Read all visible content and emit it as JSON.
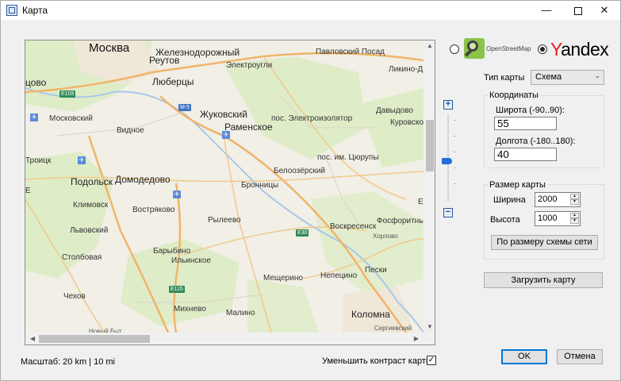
{
  "window": {
    "title": "Карта",
    "minimize": "—",
    "close": "✕"
  },
  "map": {
    "labels": {
      "moskva": "Москва",
      "zheleznodorozhny": "Железнодорожный",
      "reutov": "Реутов",
      "elektrougli": "Электроугли",
      "pavlovsky_posad": "Павловский Посад",
      "likino": "Ликино-Д",
      "lyubertsy": "Люберцы",
      "zhukovsky": "Жуковский",
      "ramenskoe": "Раменское",
      "elektroizolyator": "пос. Электроизолятор",
      "davydovo": "Давыдово",
      "kurovskoe": "Куровско",
      "moskovsky": "Московский",
      "vidnoe": "Видное",
      "tsyurupy": "пос. им. Цюрупы",
      "beloozersky": "Белоозёрский",
      "troitsk": "Троицк",
      "podolsk": "Подольск",
      "domodedovo": "Домодедово",
      "bronnitsy": "Бронницы",
      "klimovsk": "Климовск",
      "vostryakovo": "Востряково",
      "fosforitny": "Фосфоритны",
      "lvovsky": "Львовский",
      "ryleevo": "Рылеево",
      "voskresensk": "Воскресенск",
      "khorlovo": "Хорлово",
      "barybino": "Барыбино",
      "stolbovaya": "Столбовая",
      "ilyinskoe": "Ильинское",
      "peski": "Пески",
      "meshcherino": "Мещерино",
      "nepetsino": "Непецино",
      "chekhov": "Чехов",
      "mikhnevo": "Михнево",
      "malino": "Малино",
      "kolomna": "Коломна",
      "sergievsky": "Сергиевский",
      "novy_byt": "Новый Быт",
      "left_tsovo": "цово",
      "left_e": "Е",
      "right_e": "Е"
    },
    "shields": {
      "e105": "E105",
      "m5": "M-5",
      "e30": "E30",
      "e115": "E115"
    },
    "airport_glyph": "✈"
  },
  "zoom": {
    "in": "+",
    "out": "−"
  },
  "provider": {
    "osm": "OpenStreetMap",
    "yandex_y": "Y",
    "yandex_rest": "andex",
    "selected": "yandex"
  },
  "map_type": {
    "label": "Тип карты",
    "value": "Схема",
    "caret": "⌄"
  },
  "coords": {
    "title": "Координаты",
    "lat_label": "Широта (-90..90):",
    "lat_value": "55",
    "lon_label": "Долгота (-180..180):",
    "lon_value": "40"
  },
  "size": {
    "title": "Размер карты",
    "width_label": "Ширина",
    "width_value": "2000",
    "height_label": "Высота",
    "height_value": "1000",
    "fit_button": "По размеру схемы сети"
  },
  "load_button": "Загрузить карту",
  "scale_text": "Масштаб: 20 km | 10 mi",
  "contrast": {
    "label": "Уменьшить контраст карты",
    "checked": "✓"
  },
  "ok_button": "OK",
  "cancel_button": "Отмена"
}
